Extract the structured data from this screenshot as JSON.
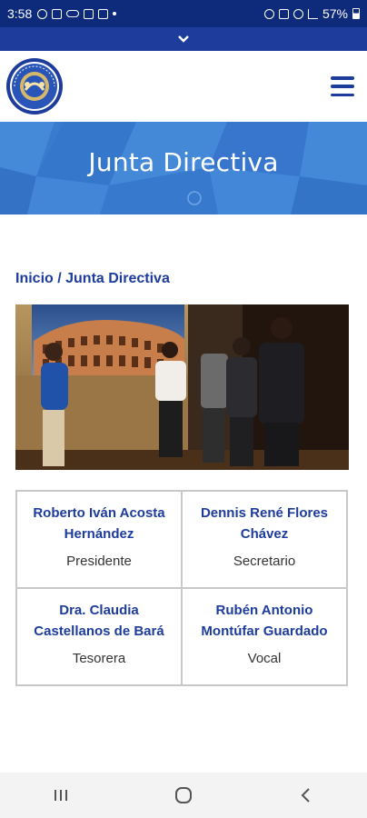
{
  "status": {
    "time": "3:58",
    "battery": "57%"
  },
  "header": {
    "logo_alt": "Asociación de Guatemaltecos logo",
    "menu_icon": "hamburger-menu-icon"
  },
  "hero": {
    "title": "Junta Directiva"
  },
  "breadcrumb": {
    "home": "Inicio",
    "separator": " / ",
    "current": "Junta Directiva"
  },
  "members": [
    {
      "name": "Roberto Iván Acosta Hernández",
      "role": "Presidente"
    },
    {
      "name": "Dennis René Flores Chávez",
      "role": "Secretario"
    },
    {
      "name": "Dra. Claudia Castellanos de Bará",
      "role": "Tesorera"
    },
    {
      "name": "Rubén Antonio Montúfar Guardado",
      "role": "Vocal"
    }
  ],
  "colors": {
    "brand_blue": "#1d3c9b",
    "status_bar": "#0e2a7a",
    "hero": "#3a7fd0"
  },
  "nav": {
    "recent_icon": "recent-apps-icon",
    "home_icon": "home-circle-icon",
    "back_icon": "back-chevron-icon"
  }
}
